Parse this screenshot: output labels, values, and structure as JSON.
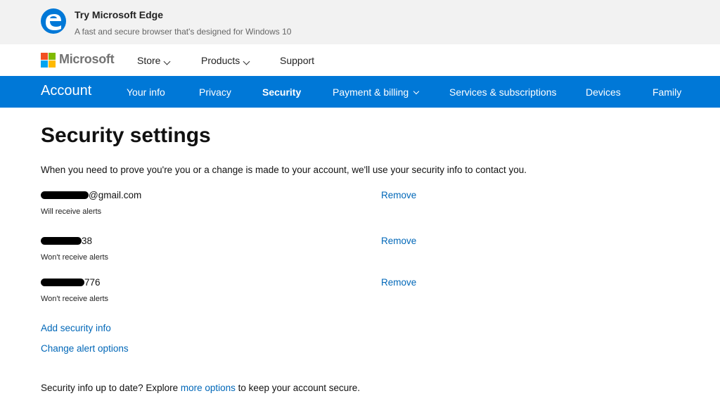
{
  "edge_banner": {
    "title": "Try Microsoft Edge",
    "subtitle": "A fast and secure browser that's designed for Windows 10",
    "icon": "edge-logo-icon",
    "accent_color": "#0078d7"
  },
  "ms_header": {
    "brand": "Microsoft",
    "logo_colors": [
      "#f25022",
      "#7fba00",
      "#00a4ef",
      "#ffb900"
    ],
    "nav": [
      {
        "label": "Store",
        "has_dropdown": true
      },
      {
        "label": "Products",
        "has_dropdown": true
      },
      {
        "label": "Support",
        "has_dropdown": false
      }
    ]
  },
  "account_nav": {
    "title": "Account",
    "bar_color": "#0078d7",
    "tabs": [
      {
        "label": "Your info"
      },
      {
        "label": "Privacy"
      },
      {
        "label": "Security",
        "active": true
      },
      {
        "label": "Payment & billing",
        "has_dropdown": true
      },
      {
        "label": "Services & subscriptions"
      },
      {
        "label": "Devices"
      },
      {
        "label": "Family"
      }
    ]
  },
  "main": {
    "title": "Security settings",
    "intro": "When you need to prove you're you or a change is made to your account, we'll use your security info to contact you.",
    "security_info": [
      {
        "value_visible": "@gmail.com",
        "redacted_prefix": true,
        "status": "Will receive alerts",
        "remove_label": "Remove"
      },
      {
        "value_visible": "38",
        "redacted_prefix": true,
        "status": "Won't receive alerts",
        "remove_label": "Remove"
      },
      {
        "value_visible": "776",
        "redacted_prefix": true,
        "status": "Won't receive alerts",
        "remove_label": "Remove"
      }
    ],
    "add_security_info": "Add security info",
    "change_alert_options": "Change alert options",
    "footer_before": "Security info up to date? Explore ",
    "footer_link": "more options",
    "footer_after": " to keep your account secure.",
    "link_color": "#0067b8"
  }
}
